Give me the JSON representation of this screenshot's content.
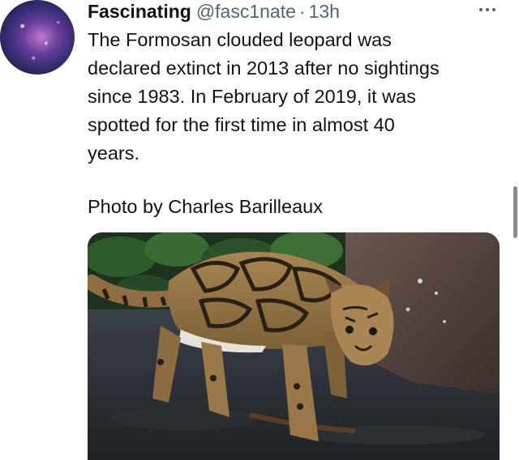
{
  "tweet": {
    "author_name": "Fascinating",
    "author_handle": "@fasc1nate",
    "separator": "·",
    "timestamp": "13h",
    "body_text": "The Formosan clouded leopard was\ndeclared extinct in 2013 after no sightings\nsince 1983. In February of 2019, it was\nspotted for the first time in almost 40\nyears.",
    "photo_credit": "Photo by Charles Barilleaux"
  },
  "icons": {
    "avatar": "galaxy-avatar",
    "more": "more-horizontal-icon"
  },
  "colors": {
    "text_primary": "#0f1419",
    "text_secondary": "#536471",
    "background": "#ffffff"
  }
}
